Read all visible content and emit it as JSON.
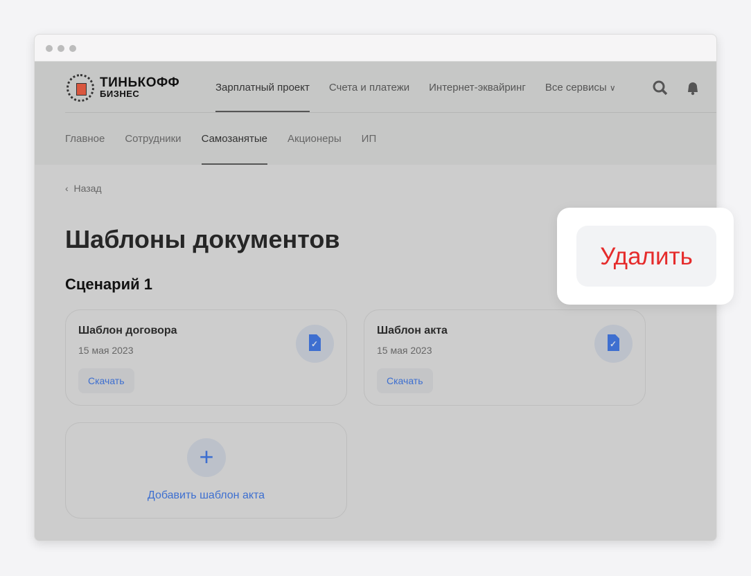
{
  "logo": {
    "name": "ТИНЬКОФФ",
    "sub": "БИЗНЕС"
  },
  "topnav": [
    {
      "label": "Зарплатный проект",
      "active": true
    },
    {
      "label": "Счета и платежи"
    },
    {
      "label": "Интернет-эквайринг"
    },
    {
      "label": "Все сервисы"
    }
  ],
  "subnav": [
    {
      "label": "Главное"
    },
    {
      "label": "Сотрудники"
    },
    {
      "label": "Самозанятые",
      "active": true
    },
    {
      "label": "Акционеры"
    },
    {
      "label": "ИП"
    }
  ],
  "back": "Назад",
  "title": "Шаблоны документов",
  "scenario": "Сценарий 1",
  "cards": [
    {
      "title": "Шаблон договора",
      "date": "15 мая 2023",
      "button": "Скачать"
    },
    {
      "title": "Шаблон акта",
      "date": "15 мая 2023",
      "button": "Скачать"
    }
  ],
  "add": {
    "label": "Добавить шаблон акта",
    "icon": "+"
  },
  "popup": {
    "delete": "Удалить"
  },
  "colors": {
    "accent": "#3d6fd0",
    "danger": "#e52b2b"
  }
}
